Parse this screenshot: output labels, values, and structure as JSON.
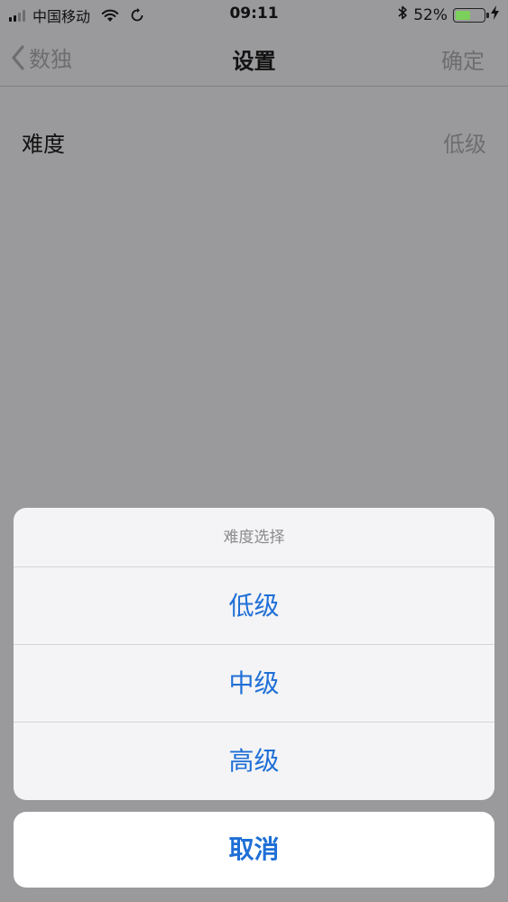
{
  "status_bar": {
    "carrier": "中国移动",
    "time": "09:11",
    "battery_percent": "52%",
    "battery_level": 0.52,
    "icons": [
      "signal-icon",
      "wifi-icon",
      "sync-icon",
      "bluetooth-icon",
      "battery-icon",
      "charging-icon"
    ]
  },
  "nav": {
    "back_label": "数独",
    "title": "设置",
    "confirm_label": "确定"
  },
  "settings": {
    "difficulty_label": "难度",
    "difficulty_value": "低级"
  },
  "action_sheet": {
    "title": "难度选择",
    "options": [
      "低级",
      "中级",
      "高级"
    ],
    "cancel_label": "取消"
  },
  "colors": {
    "overlay_bg": "#9a999c",
    "accent": "#1f6fd6",
    "battery_fill": "#7bd05b"
  }
}
